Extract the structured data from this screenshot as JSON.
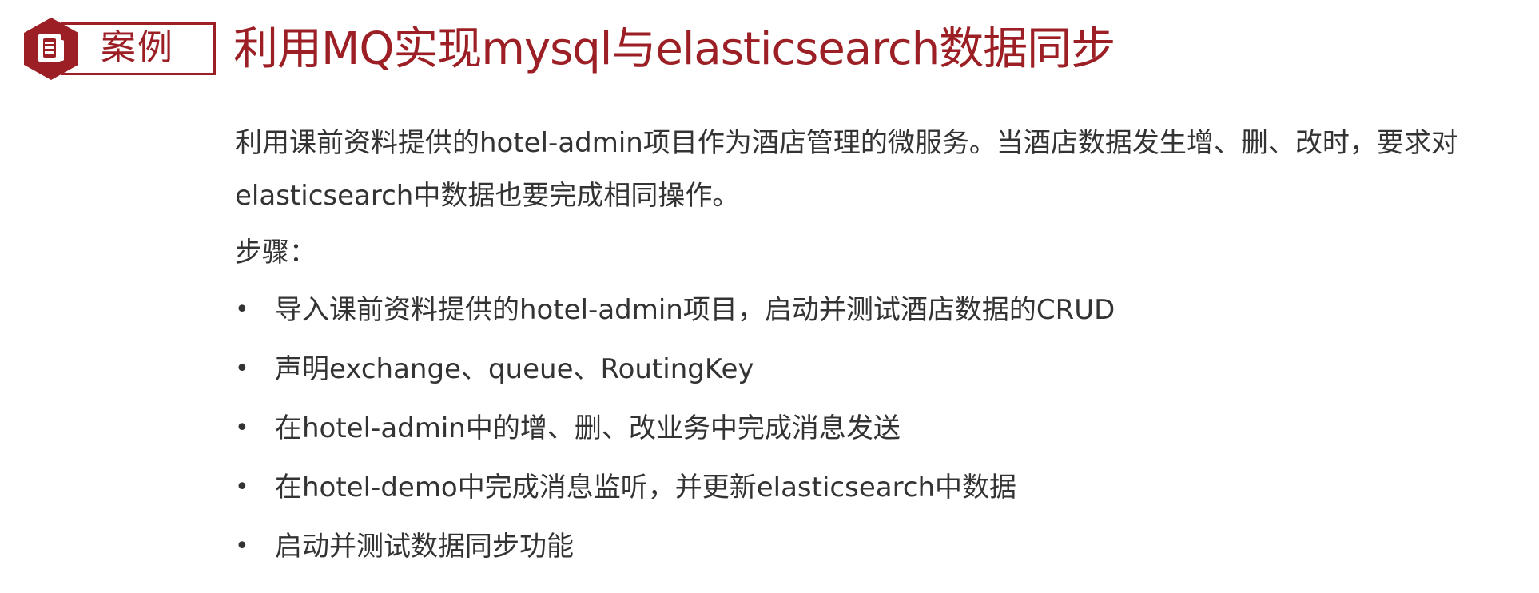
{
  "badge": {
    "label": "案例",
    "icon": "document-icon",
    "color": "#9b1f24"
  },
  "title": "利用MQ实现mysql与elasticsearch数据同步",
  "intro": "利用课前资料提供的hotel-admin项目作为酒店管理的微服务。当酒店数据发生增、删、改时，要求对elasticsearch中数据也要完成相同操作。",
  "steps_label": "步骤：",
  "bullet_symbol": "•",
  "steps": [
    "导入课前资料提供的hotel-admin项目，启动并测试酒店数据的CRUD",
    "声明exchange、queue、RoutingKey",
    "在hotel-admin中的增、删、改业务中完成消息发送",
    "在hotel-demo中完成消息监听，并更新elasticsearch中数据",
    "启动并测试数据同步功能"
  ]
}
